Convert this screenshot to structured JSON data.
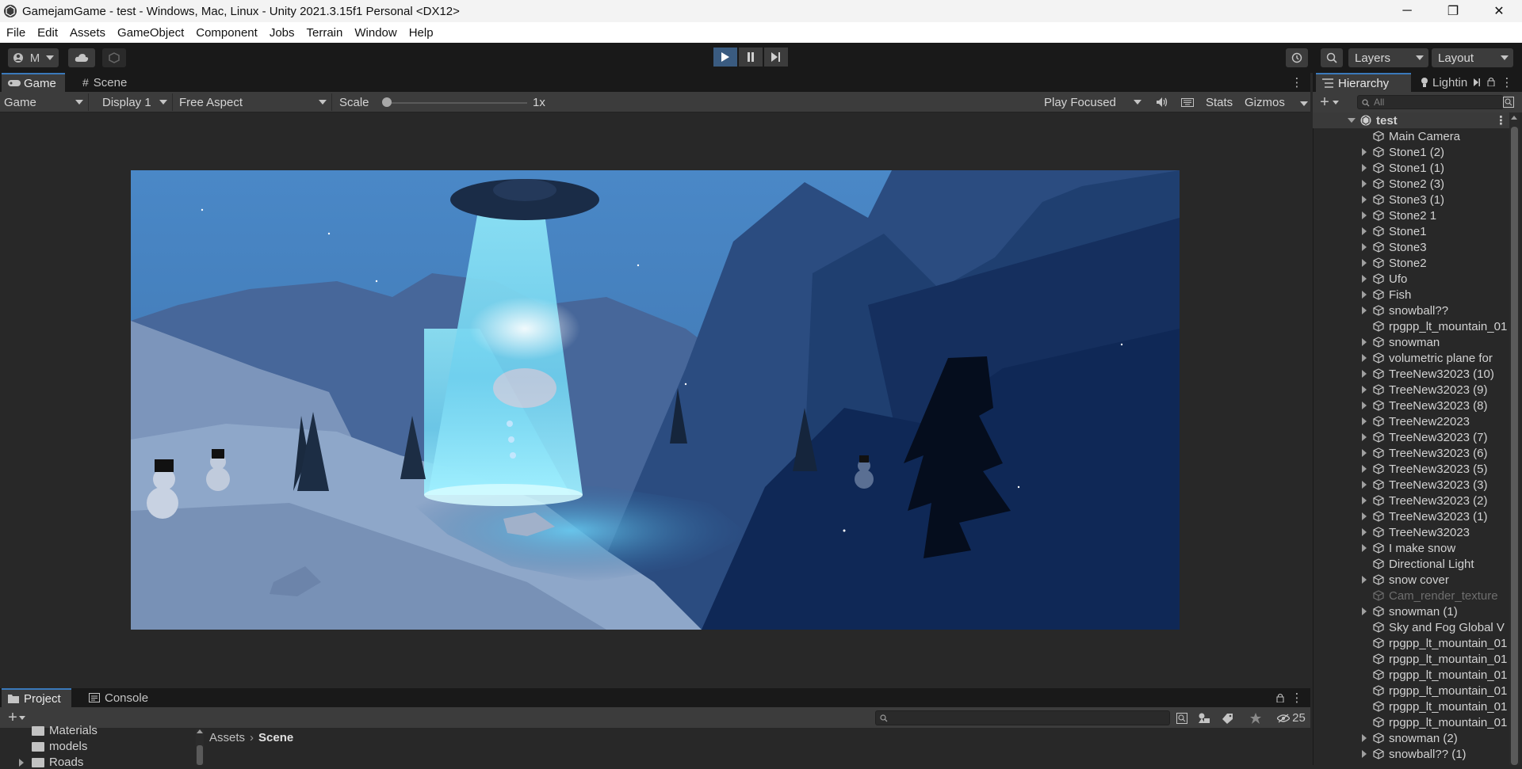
{
  "window": {
    "title": "GamejamGame - test - Windows, Mac, Linux - Unity 2021.3.15f1 Personal <DX12>",
    "minimize_label": "─",
    "restore_label": "❐",
    "close_label": "✕"
  },
  "menu": [
    "File",
    "Edit",
    "Assets",
    "GameObject",
    "Component",
    "Jobs",
    "Terrain",
    "Window",
    "Help"
  ],
  "toolbar": {
    "account_label": "M",
    "layers_label": "Layers",
    "layout_label": "Layout"
  },
  "game_panel": {
    "tabs": [
      "Game",
      "Scene"
    ],
    "view_mode": "Game",
    "display": "Display 1",
    "aspect": "Free Aspect",
    "scale_label": "Scale",
    "scale_value": "1x",
    "scale_fraction": 0.0,
    "play_mode": "Play Focused",
    "stats_label": "Stats",
    "gizmos_label": "Gizmos"
  },
  "project_panel": {
    "tabs": [
      "Project",
      "Console"
    ],
    "folders": [
      "Materials",
      "models",
      "Roads"
    ],
    "breadcrumb": [
      "Assets",
      "Scene"
    ],
    "hidden_count": "25"
  },
  "hierarchy": {
    "tabs": [
      "Hierarchy",
      "Lightin"
    ],
    "search_placeholder": "All",
    "scene": "test",
    "items": [
      {
        "name": "Main Camera",
        "expandable": false,
        "dim": false
      },
      {
        "name": "Stone1 (2)",
        "expandable": true,
        "dim": false
      },
      {
        "name": "Stone1 (1)",
        "expandable": true,
        "dim": false
      },
      {
        "name": "Stone2 (3)",
        "expandable": true,
        "dim": false
      },
      {
        "name": "Stone3 (1)",
        "expandable": true,
        "dim": false
      },
      {
        "name": "Stone2 1",
        "expandable": true,
        "dim": false
      },
      {
        "name": "Stone1",
        "expandable": true,
        "dim": false
      },
      {
        "name": "Stone3",
        "expandable": true,
        "dim": false
      },
      {
        "name": "Stone2",
        "expandable": true,
        "dim": false
      },
      {
        "name": "Ufo",
        "expandable": true,
        "dim": false
      },
      {
        "name": "Fish",
        "expandable": true,
        "dim": false
      },
      {
        "name": "snowball??",
        "expandable": true,
        "dim": false
      },
      {
        "name": "rpgpp_lt_mountain_01",
        "expandable": false,
        "dim": false
      },
      {
        "name": "snowman",
        "expandable": true,
        "dim": false
      },
      {
        "name": "volumetric plane for",
        "expandable": true,
        "dim": false
      },
      {
        "name": "TreeNew32023 (10)",
        "expandable": true,
        "dim": false
      },
      {
        "name": "TreeNew32023 (9)",
        "expandable": true,
        "dim": false
      },
      {
        "name": "TreeNew32023 (8)",
        "expandable": true,
        "dim": false
      },
      {
        "name": "TreeNew22023",
        "expandable": true,
        "dim": false
      },
      {
        "name": "TreeNew32023 (7)",
        "expandable": true,
        "dim": false
      },
      {
        "name": "TreeNew32023 (6)",
        "expandable": true,
        "dim": false
      },
      {
        "name": "TreeNew32023 (5)",
        "expandable": true,
        "dim": false
      },
      {
        "name": "TreeNew32023 (3)",
        "expandable": true,
        "dim": false
      },
      {
        "name": "TreeNew32023 (2)",
        "expandable": true,
        "dim": false
      },
      {
        "name": "TreeNew32023 (1)",
        "expandable": true,
        "dim": false
      },
      {
        "name": "TreeNew32023",
        "expandable": true,
        "dim": false
      },
      {
        "name": "I make snow",
        "expandable": true,
        "dim": false
      },
      {
        "name": "Directional Light",
        "expandable": false,
        "dim": false
      },
      {
        "name": "snow cover",
        "expandable": true,
        "dim": false
      },
      {
        "name": "Cam_render_texture",
        "expandable": false,
        "dim": true
      },
      {
        "name": "snowman (1)",
        "expandable": true,
        "dim": false
      },
      {
        "name": "Sky and Fog Global V",
        "expandable": false,
        "dim": false
      },
      {
        "name": "rpgpp_lt_mountain_01",
        "expandable": false,
        "dim": false
      },
      {
        "name": "rpgpp_lt_mountain_01",
        "expandable": false,
        "dim": false
      },
      {
        "name": "rpgpp_lt_mountain_01",
        "expandable": false,
        "dim": false
      },
      {
        "name": "rpgpp_lt_mountain_01",
        "expandable": false,
        "dim": false
      },
      {
        "name": "rpgpp_lt_mountain_01",
        "expandable": false,
        "dim": false
      },
      {
        "name": "rpgpp_lt_mountain_01",
        "expandable": false,
        "dim": false
      },
      {
        "name": "snowman (2)",
        "expandable": true,
        "dim": false
      },
      {
        "name": "snowball?? (1)",
        "expandable": true,
        "dim": false
      }
    ]
  },
  "colors": {
    "accent": "#3a79bb",
    "panel": "#282828",
    "toolbar": "#3c3c3c"
  }
}
